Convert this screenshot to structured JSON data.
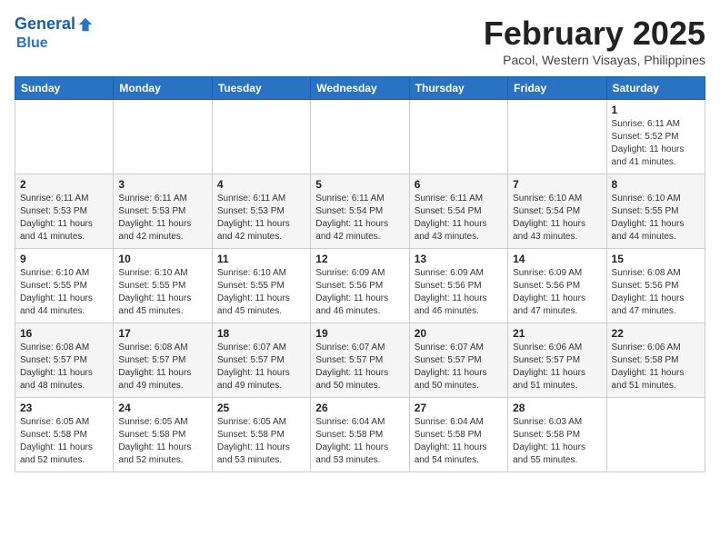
{
  "header": {
    "logo_line1": "General",
    "logo_line2": "Blue",
    "month": "February 2025",
    "location": "Pacol, Western Visayas, Philippines"
  },
  "weekdays": [
    "Sunday",
    "Monday",
    "Tuesday",
    "Wednesday",
    "Thursday",
    "Friday",
    "Saturday"
  ],
  "weeks": [
    [
      {
        "day": "",
        "info": ""
      },
      {
        "day": "",
        "info": ""
      },
      {
        "day": "",
        "info": ""
      },
      {
        "day": "",
        "info": ""
      },
      {
        "day": "",
        "info": ""
      },
      {
        "day": "",
        "info": ""
      },
      {
        "day": "1",
        "info": "Sunrise: 6:11 AM\nSunset: 5:52 PM\nDaylight: 11 hours\nand 41 minutes."
      }
    ],
    [
      {
        "day": "2",
        "info": "Sunrise: 6:11 AM\nSunset: 5:53 PM\nDaylight: 11 hours\nand 41 minutes."
      },
      {
        "day": "3",
        "info": "Sunrise: 6:11 AM\nSunset: 5:53 PM\nDaylight: 11 hours\nand 42 minutes."
      },
      {
        "day": "4",
        "info": "Sunrise: 6:11 AM\nSunset: 5:53 PM\nDaylight: 11 hours\nand 42 minutes."
      },
      {
        "day": "5",
        "info": "Sunrise: 6:11 AM\nSunset: 5:54 PM\nDaylight: 11 hours\nand 42 minutes."
      },
      {
        "day": "6",
        "info": "Sunrise: 6:11 AM\nSunset: 5:54 PM\nDaylight: 11 hours\nand 43 minutes."
      },
      {
        "day": "7",
        "info": "Sunrise: 6:10 AM\nSunset: 5:54 PM\nDaylight: 11 hours\nand 43 minutes."
      },
      {
        "day": "8",
        "info": "Sunrise: 6:10 AM\nSunset: 5:55 PM\nDaylight: 11 hours\nand 44 minutes."
      }
    ],
    [
      {
        "day": "9",
        "info": "Sunrise: 6:10 AM\nSunset: 5:55 PM\nDaylight: 11 hours\nand 44 minutes."
      },
      {
        "day": "10",
        "info": "Sunrise: 6:10 AM\nSunset: 5:55 PM\nDaylight: 11 hours\nand 45 minutes."
      },
      {
        "day": "11",
        "info": "Sunrise: 6:10 AM\nSunset: 5:55 PM\nDaylight: 11 hours\nand 45 minutes."
      },
      {
        "day": "12",
        "info": "Sunrise: 6:09 AM\nSunset: 5:56 PM\nDaylight: 11 hours\nand 46 minutes."
      },
      {
        "day": "13",
        "info": "Sunrise: 6:09 AM\nSunset: 5:56 PM\nDaylight: 11 hours\nand 46 minutes."
      },
      {
        "day": "14",
        "info": "Sunrise: 6:09 AM\nSunset: 5:56 PM\nDaylight: 11 hours\nand 47 minutes."
      },
      {
        "day": "15",
        "info": "Sunrise: 6:08 AM\nSunset: 5:56 PM\nDaylight: 11 hours\nand 47 minutes."
      }
    ],
    [
      {
        "day": "16",
        "info": "Sunrise: 6:08 AM\nSunset: 5:57 PM\nDaylight: 11 hours\nand 48 minutes."
      },
      {
        "day": "17",
        "info": "Sunrise: 6:08 AM\nSunset: 5:57 PM\nDaylight: 11 hours\nand 49 minutes."
      },
      {
        "day": "18",
        "info": "Sunrise: 6:07 AM\nSunset: 5:57 PM\nDaylight: 11 hours\nand 49 minutes."
      },
      {
        "day": "19",
        "info": "Sunrise: 6:07 AM\nSunset: 5:57 PM\nDaylight: 11 hours\nand 50 minutes."
      },
      {
        "day": "20",
        "info": "Sunrise: 6:07 AM\nSunset: 5:57 PM\nDaylight: 11 hours\nand 50 minutes."
      },
      {
        "day": "21",
        "info": "Sunrise: 6:06 AM\nSunset: 5:57 PM\nDaylight: 11 hours\nand 51 minutes."
      },
      {
        "day": "22",
        "info": "Sunrise: 6:06 AM\nSunset: 5:58 PM\nDaylight: 11 hours\nand 51 minutes."
      }
    ],
    [
      {
        "day": "23",
        "info": "Sunrise: 6:05 AM\nSunset: 5:58 PM\nDaylight: 11 hours\nand 52 minutes."
      },
      {
        "day": "24",
        "info": "Sunrise: 6:05 AM\nSunset: 5:58 PM\nDaylight: 11 hours\nand 52 minutes."
      },
      {
        "day": "25",
        "info": "Sunrise: 6:05 AM\nSunset: 5:58 PM\nDaylight: 11 hours\nand 53 minutes."
      },
      {
        "day": "26",
        "info": "Sunrise: 6:04 AM\nSunset: 5:58 PM\nDaylight: 11 hours\nand 53 minutes."
      },
      {
        "day": "27",
        "info": "Sunrise: 6:04 AM\nSunset: 5:58 PM\nDaylight: 11 hours\nand 54 minutes."
      },
      {
        "day": "28",
        "info": "Sunrise: 6:03 AM\nSunset: 5:58 PM\nDaylight: 11 hours\nand 55 minutes."
      },
      {
        "day": "",
        "info": ""
      }
    ]
  ]
}
